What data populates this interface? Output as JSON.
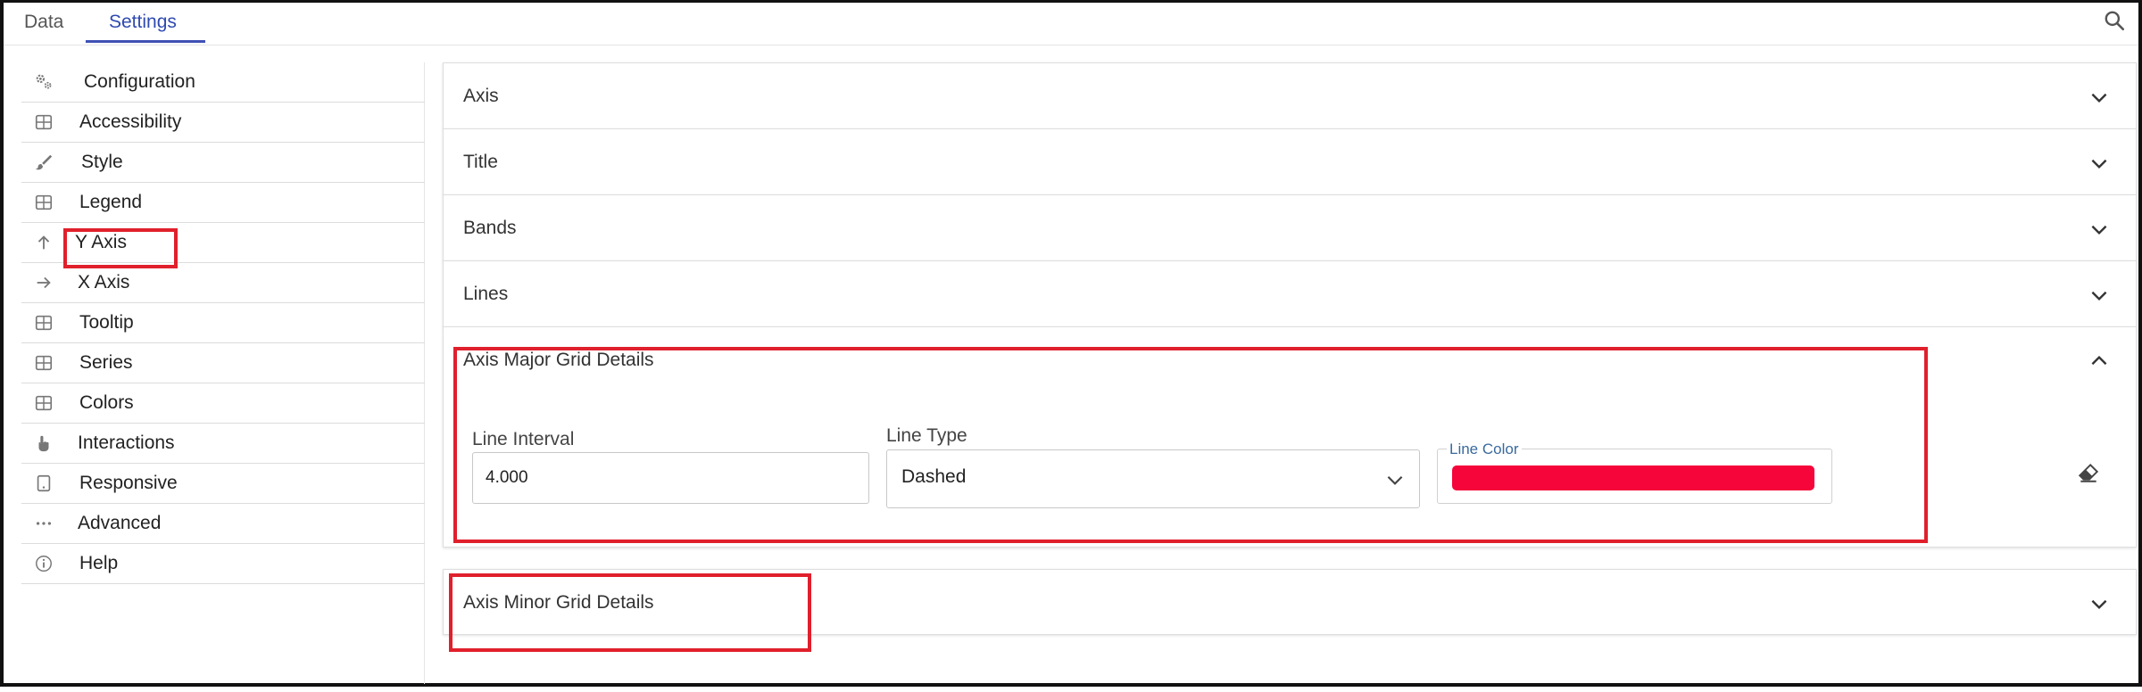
{
  "tabs": [
    {
      "label": "Data"
    },
    {
      "label": "Settings",
      "active": true
    }
  ],
  "sidebar": {
    "items": [
      {
        "label": "Configuration",
        "icon": "gears-icon"
      },
      {
        "label": "Accessibility",
        "icon": "grid-icon"
      },
      {
        "label": "Style",
        "icon": "brush-icon"
      },
      {
        "label": "Legend",
        "icon": "grid-icon"
      },
      {
        "label": "Y Axis",
        "icon": "arrow-up-icon"
      },
      {
        "label": "X Axis",
        "icon": "arrow-right-icon"
      },
      {
        "label": "Tooltip",
        "icon": "grid-icon"
      },
      {
        "label": "Series",
        "icon": "grid-icon"
      },
      {
        "label": "Colors",
        "icon": "grid-icon"
      },
      {
        "label": "Interactions",
        "icon": "pointer-hand-icon"
      },
      {
        "label": "Responsive",
        "icon": "device-icon"
      },
      {
        "label": "Advanced",
        "icon": "more-horizontal-icon"
      },
      {
        "label": "Help",
        "icon": "info-icon"
      }
    ]
  },
  "accordion": {
    "axis": "Axis",
    "title": "Title",
    "bands": "Bands",
    "lines": "Lines",
    "major_grid": {
      "header": "Axis Major Grid Details",
      "expanded": true,
      "line_interval_label": "Line Interval",
      "line_interval_value": "4.000",
      "line_type_label": "Line Type",
      "line_type_value": "Dashed",
      "line_color_label": "Line Color",
      "line_color_value": "#f5053a"
    },
    "minor_grid": {
      "header": "Axis Minor Grid Details",
      "expanded": false
    }
  },
  "colors": {
    "accent": "#3f51b5",
    "highlight": "#e0202c"
  }
}
